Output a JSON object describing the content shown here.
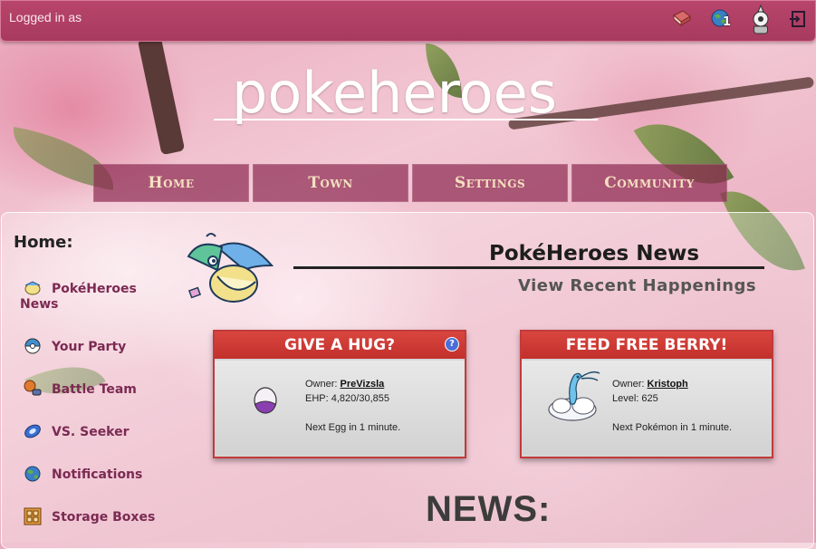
{
  "topbar": {
    "login_text": "Logged in as",
    "icons": [
      "book-icon",
      "globe-notification-icon",
      "avatar-icon",
      "logout-icon"
    ],
    "notification_count": "1"
  },
  "site": {
    "logo": "pokeheroes"
  },
  "nav": {
    "items": [
      {
        "label": "Home"
      },
      {
        "label": "Town"
      },
      {
        "label": "Settings"
      },
      {
        "label": "Community"
      }
    ]
  },
  "sidebar": {
    "title": "Home:",
    "items": [
      {
        "label": "PokéHeroes News",
        "icon": "pelipper-icon"
      },
      {
        "label": "Your Party",
        "icon": "pokeball-icon"
      },
      {
        "label": "Battle Team",
        "icon": "battle-icon"
      },
      {
        "label": "VS. Seeker",
        "icon": "vs-seeker-icon"
      },
      {
        "label": "Notifications",
        "icon": "globe-icon"
      },
      {
        "label": "Storage Boxes",
        "icon": "box-icon"
      }
    ]
  },
  "main": {
    "news_title": "PokéHeroes News",
    "news_subtitle": "View Recent Happenings",
    "news_heading": "NEWS:"
  },
  "cards": [
    {
      "title": "GIVE A HUG?",
      "owner_label": "Owner:",
      "owner": "PreVizsla",
      "stat_label": "EHP:",
      "stat": "4,820/30,855",
      "note": "Next Egg in 1 minute."
    },
    {
      "title": "FEED FREE BERRY!",
      "owner_label": "Owner:",
      "owner": "Kristoph",
      "stat_label": "Level:",
      "stat": "625",
      "note": "Next Pokémon in 1 minute."
    }
  ],
  "colors": {
    "topbar": "#b8456b",
    "nav": "#8c2850",
    "card_header": "#d9463f",
    "sidebar_link": "#7b2a52"
  }
}
